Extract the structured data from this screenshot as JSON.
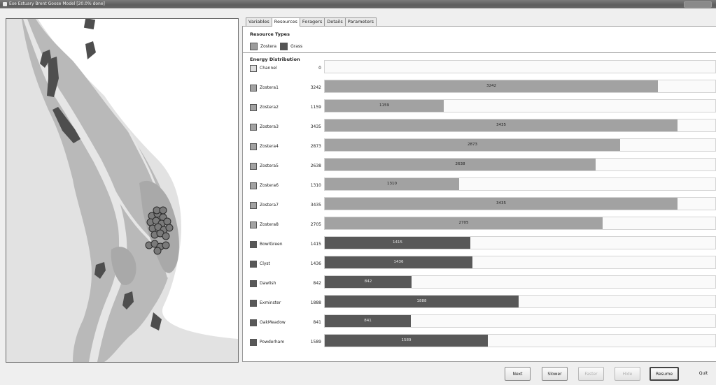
{
  "window": {
    "title": "Exe Estuary Brent Goose Model [20.0% done]"
  },
  "tabs": [
    "Variables",
    "Resources",
    "Foragers",
    "Details",
    "Parameters"
  ],
  "active_tab": "Resources",
  "resource_types": {
    "title": "Resource Types",
    "items": [
      {
        "label": "Zostera",
        "color": "#9c9c9c"
      },
      {
        "label": "Grass",
        "color": "#555555"
      }
    ]
  },
  "energy": {
    "title": "Energy Distribution",
    "max_value": 3800,
    "rows": [
      {
        "name": "Channel",
        "value": 0,
        "bar_label": "",
        "color": "#dcdcdc",
        "type": "channel"
      },
      {
        "name": "Zostera1",
        "value": 3242,
        "bar_label": "3242",
        "color": "#a2a2a2",
        "type": "zostera"
      },
      {
        "name": "Zostera2",
        "value": 1159,
        "bar_label": "1159",
        "color": "#a2a2a2",
        "type": "zostera"
      },
      {
        "name": "Zostera3",
        "value": 3435,
        "bar_label": "3435",
        "color": "#a2a2a2",
        "type": "zostera"
      },
      {
        "name": "Zostera4",
        "value": 2873,
        "bar_label": "2873",
        "color": "#a2a2a2",
        "type": "zostera"
      },
      {
        "name": "Zostera5",
        "value": 2638,
        "bar_label": "2638",
        "color": "#a2a2a2",
        "type": "zostera"
      },
      {
        "name": "Zostera6",
        "value": 1310,
        "bar_label": "1310",
        "color": "#a2a2a2",
        "type": "zostera"
      },
      {
        "name": "Zostera7",
        "value": 3435,
        "bar_label": "3435",
        "color": "#a2a2a2",
        "type": "zostera"
      },
      {
        "name": "Zostera8",
        "value": 2705,
        "bar_label": "2705",
        "color": "#a2a2a2",
        "type": "zostera"
      },
      {
        "name": "BowlGreen",
        "value": 1415,
        "bar_label": "1415",
        "color": "#585858",
        "type": "grass"
      },
      {
        "name": "Clyst",
        "value": 1436,
        "bar_label": "1436",
        "color": "#585858",
        "type": "grass"
      },
      {
        "name": "Dawlish",
        "value": 842,
        "bar_label": "842",
        "color": "#585858",
        "type": "grass"
      },
      {
        "name": "Exminster",
        "value": 1888,
        "bar_label": "1888",
        "color": "#585858",
        "type": "grass"
      },
      {
        "name": "OakMeadow",
        "value": 841,
        "bar_label": "841",
        "color": "#585858",
        "type": "grass"
      },
      {
        "name": "Powderham",
        "value": 1589,
        "bar_label": "1589",
        "color": "#585858",
        "type": "grass"
      }
    ]
  },
  "buttons": {
    "next": "Next",
    "slower": "Slower",
    "faster": "Faster",
    "hide": "Hide",
    "resume": "Resume",
    "quit": "Quit"
  }
}
